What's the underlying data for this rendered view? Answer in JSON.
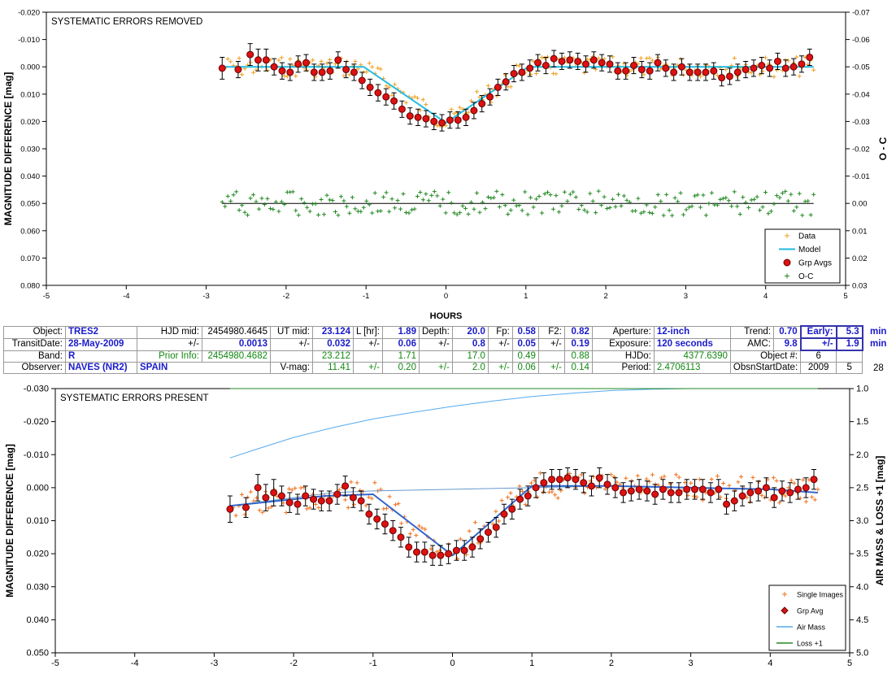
{
  "chart_data": [
    {
      "type": "scatter",
      "title": "SYSTEMATIC ERRORS REMOVED",
      "xlabel": "HOURS",
      "ylabel": "MAGNITUDE DIFFERENCE [mag]",
      "y2label": "O - C",
      "xlim": [
        -5,
        5
      ],
      "ylim": [
        -0.02,
        0.08
      ],
      "y_inverted": true,
      "y2lim": [
        -0.07,
        0.03
      ],
      "x_ticks": [
        "-5",
        "-4",
        "-3",
        "-2",
        "-1",
        "0",
        "1",
        "2",
        "3",
        "4",
        "5"
      ],
      "y_ticks": [
        "-0.020",
        "-0.010",
        "0.000",
        "0.010",
        "0.020",
        "0.030",
        "0.040",
        "0.050",
        "0.060",
        "0.070",
        "0.080"
      ],
      "y2_ticks": [
        "-0.07",
        "-0.06",
        "-0.05",
        "-0.04",
        "-0.03",
        "-0.02",
        "-0.01",
        "0.00",
        "0.01",
        "0.02",
        "0.03"
      ],
      "legend": {
        "position": "bottom-right",
        "entries": [
          "Data",
          "Model",
          "Grp Avgs",
          "O-C"
        ]
      },
      "colors": {
        "data": "#f0a020",
        "model": "#22bbdd",
        "grp": "#dd1111",
        "oc": "#228822",
        "baseline": "#000000"
      },
      "model": {
        "x": [
          -2.8,
          -1.03,
          0.0,
          1.03,
          4.6
        ],
        "y": [
          0.0,
          0.0,
          0.0205,
          0.0,
          0.0
        ]
      },
      "grp_avgs": {
        "x": [
          -2.8,
          -2.6,
          -2.45,
          -2.35,
          -2.25,
          -2.15,
          -2.05,
          -1.95,
          -1.85,
          -1.75,
          -1.65,
          -1.55,
          -1.45,
          -1.35,
          -1.25,
          -1.15,
          -1.05,
          -0.95,
          -0.85,
          -0.75,
          -0.65,
          -0.55,
          -0.45,
          -0.35,
          -0.25,
          -0.15,
          -0.05,
          0.05,
          0.15,
          0.25,
          0.35,
          0.45,
          0.55,
          0.65,
          0.75,
          0.85,
          0.95,
          1.05,
          1.15,
          1.25,
          1.35,
          1.45,
          1.55,
          1.65,
          1.75,
          1.85,
          1.95,
          2.05,
          2.15,
          2.25,
          2.35,
          2.45,
          2.55,
          2.65,
          2.75,
          2.85,
          2.95,
          3.05,
          3.15,
          3.25,
          3.35,
          3.45,
          3.55,
          3.65,
          3.75,
          3.85,
          3.95,
          4.05,
          4.15,
          4.25,
          4.35,
          4.45,
          4.55
        ],
        "y": [
          0.0005,
          0.001,
          -0.0045,
          -0.0025,
          -0.0025,
          0.0,
          0.0015,
          0.002,
          -0.001,
          -0.0015,
          0.002,
          0.002,
          0.0015,
          -0.0025,
          0.001,
          0.002,
          0.005,
          0.0075,
          0.0095,
          0.011,
          0.0125,
          0.0155,
          0.018,
          0.0185,
          0.019,
          0.02,
          0.0205,
          0.0195,
          0.0195,
          0.0185,
          0.016,
          0.0135,
          0.011,
          0.0075,
          0.0055,
          0.0025,
          0.002,
          0.0005,
          -0.0015,
          -0.0005,
          -0.003,
          -0.002,
          -0.0025,
          -0.002,
          -0.001,
          -0.0025,
          -0.0015,
          -0.001,
          0.0015,
          0.0015,
          -0.0005,
          0.001,
          0.0015,
          -0.0015,
          0.0005,
          0.002,
          0.0,
          0.002,
          0.002,
          0.002,
          0.0015,
          0.004,
          0.0035,
          0.002,
          0.001,
          0.0005,
          -0.0005,
          0.0005,
          -0.002,
          0.0005,
          0.0,
          -0.001,
          -0.0035
        ],
        "err": [
          0.004,
          0.003,
          0.004,
          0.004,
          0.004,
          0.003,
          0.003,
          0.003,
          0.003,
          0.003,
          0.003,
          0.003,
          0.003,
          0.003,
          0.003,
          0.003,
          0.003,
          0.003,
          0.003,
          0.003,
          0.003,
          0.003,
          0.003,
          0.003,
          0.003,
          0.003,
          0.003,
          0.003,
          0.003,
          0.003,
          0.003,
          0.003,
          0.003,
          0.003,
          0.003,
          0.003,
          0.003,
          0.003,
          0.003,
          0.003,
          0.003,
          0.003,
          0.003,
          0.003,
          0.003,
          0.003,
          0.003,
          0.003,
          0.003,
          0.003,
          0.003,
          0.003,
          0.003,
          0.003,
          0.003,
          0.003,
          0.003,
          0.003,
          0.003,
          0.003,
          0.003,
          0.003,
          0.003,
          0.003,
          0.003,
          0.003,
          0.003,
          0.003,
          0.003,
          0.003,
          0.003,
          0.003,
          0.003
        ]
      },
      "oc_baseline": 0.0
    },
    {
      "type": "scatter",
      "title": "SYSTEMATIC ERRORS PRESENT",
      "ylabel": "MAGNITUDE DIFFERENCE [mag]",
      "y2label": "AIR MASS & LOSS +1 [mag]",
      "xlim": [
        -5,
        5
      ],
      "ylim": [
        -0.03,
        0.05
      ],
      "y_inverted": true,
      "y2lim": [
        1.0,
        5.0
      ],
      "x_ticks": [
        "-5",
        "-4",
        "-3",
        "-2",
        "-1",
        "0",
        "1",
        "2",
        "3",
        "4",
        "5"
      ],
      "y_ticks": [
        "-0.030",
        "-0.020",
        "-0.010",
        "0.000",
        "0.010",
        "0.020",
        "0.030",
        "0.040",
        "0.050"
      ],
      "y2_ticks": [
        "5.0",
        "4.5",
        "4.0",
        "3.5",
        "3.0",
        "2.5",
        "2.0",
        "1.5",
        "1.0"
      ],
      "legend": {
        "position": "bottom-right",
        "entries": [
          "Single Images",
          "Grp Avg",
          "Air Mass",
          "Loss +1"
        ]
      },
      "colors": {
        "single": "#f0701a",
        "grp": "#dd1111",
        "airmass": "#55aaee",
        "loss": "#228822",
        "model": "#3366cc",
        "trend": "#6699cc"
      },
      "grp_avg": {
        "x": [
          -2.8,
          -2.6,
          -2.45,
          -2.35,
          -2.25,
          -2.15,
          -2.05,
          -1.95,
          -1.85,
          -1.75,
          -1.65,
          -1.55,
          -1.45,
          -1.35,
          -1.25,
          -1.15,
          -1.05,
          -0.95,
          -0.85,
          -0.75,
          -0.65,
          -0.55,
          -0.45,
          -0.35,
          -0.25,
          -0.15,
          -0.05,
          0.05,
          0.15,
          0.25,
          0.35,
          0.45,
          0.55,
          0.65,
          0.75,
          0.85,
          0.95,
          1.05,
          1.15,
          1.25,
          1.35,
          1.45,
          1.55,
          1.65,
          1.75,
          1.85,
          1.95,
          2.05,
          2.15,
          2.25,
          2.35,
          2.45,
          2.55,
          2.65,
          2.75,
          2.85,
          2.95,
          3.05,
          3.15,
          3.25,
          3.35,
          3.45,
          3.55,
          3.65,
          3.75,
          3.85,
          3.95,
          4.05,
          4.15,
          4.25,
          4.35,
          4.45,
          4.55
        ],
        "y": [
          0.0065,
          0.006,
          0.0,
          0.003,
          0.0015,
          0.0025,
          0.0045,
          0.005,
          0.0025,
          0.0035,
          0.004,
          0.004,
          0.002,
          -0.0005,
          0.003,
          0.004,
          0.008,
          0.0095,
          0.011,
          0.013,
          0.015,
          0.018,
          0.0195,
          0.0195,
          0.0205,
          0.0205,
          0.02,
          0.019,
          0.019,
          0.018,
          0.0155,
          0.0135,
          0.012,
          0.008,
          0.0065,
          0.0035,
          0.0025,
          0.0,
          -0.0015,
          -0.0025,
          -0.0025,
          -0.003,
          -0.0025,
          -0.0015,
          -0.0005,
          -0.003,
          -0.001,
          0.0,
          0.0015,
          0.001,
          0.0005,
          0.001,
          0.002,
          0.0005,
          0.0015,
          0.0015,
          0.0005,
          0.0005,
          0.0005,
          0.0015,
          0.0005,
          0.005,
          0.004,
          0.0025,
          0.0015,
          0.001,
          0.0,
          0.003,
          0.001,
          0.0015,
          0.0005,
          0.0,
          -0.0025
        ],
        "err": [
          0.004,
          0.003,
          0.004,
          0.004,
          0.004,
          0.003,
          0.003,
          0.003,
          0.003,
          0.003,
          0.003,
          0.003,
          0.003,
          0.003,
          0.003,
          0.003,
          0.003,
          0.003,
          0.003,
          0.003,
          0.003,
          0.003,
          0.003,
          0.003,
          0.003,
          0.003,
          0.003,
          0.003,
          0.003,
          0.003,
          0.003,
          0.003,
          0.003,
          0.003,
          0.003,
          0.003,
          0.003,
          0.003,
          0.003,
          0.003,
          0.003,
          0.003,
          0.003,
          0.003,
          0.003,
          0.003,
          0.003,
          0.003,
          0.003,
          0.003,
          0.003,
          0.003,
          0.003,
          0.003,
          0.003,
          0.003,
          0.003,
          0.003,
          0.003,
          0.003,
          0.003,
          0.003,
          0.003,
          0.003,
          0.003,
          0.003,
          0.003,
          0.003,
          0.003,
          0.003,
          0.003,
          0.003,
          0.003
        ]
      },
      "model_curve": {
        "x": [
          -2.8,
          -2.0,
          -1.6,
          -1.0,
          0.0,
          1.0,
          2.0,
          3.0,
          4.0,
          4.6
        ],
        "y": [
          0.0055,
          0.0035,
          0.0025,
          0.002,
          0.0205,
          -0.0005,
          -0.0005,
          0.0,
          0.0005,
          0.0015
        ]
      },
      "trend_curve": {
        "x": [
          -2.8,
          -2.0,
          -1.5,
          -1.0,
          0.0,
          1.0,
          2.0,
          3.0,
          4.0,
          4.6
        ],
        "y": [
          0.0055,
          0.003,
          0.0015,
          0.001,
          0.0005,
          0.0,
          -0.0005,
          0.0,
          0.0005,
          0.0015
        ]
      },
      "air_mass": {
        "x": [
          -2.8,
          -2.5,
          -2.0,
          -1.5,
          -1.0,
          -0.5,
          0.0,
          0.5,
          1.0,
          1.5,
          2.0,
          2.5,
          3.0,
          3.5,
          4.0
        ],
        "y": [
          2.05,
          1.93,
          1.74,
          1.59,
          1.46,
          1.36,
          1.27,
          1.19,
          1.12,
          1.07,
          1.03,
          1.01,
          1.0,
          1.0,
          1.0
        ]
      },
      "loss": {
        "x": [
          -2.8,
          4.6
        ],
        "y": [
          1.0,
          1.0
        ]
      }
    }
  ],
  "info": {
    "object_label": "Object:",
    "object": "TRES2",
    "hjd_mid_label": "HJD mid:",
    "hjd_mid": "2454980.4645",
    "ut_mid_label": "UT mid:",
    "ut_mid": "23.124",
    "l_hr_label": "L [hr]:",
    "l_hr": "1.89",
    "depth_label": "Depth:",
    "depth": "20.0",
    "fp_label": "Fp:",
    "fp": "0.58",
    "f2_label": "F2:",
    "f2": "0.82",
    "aperture_label": "Aperture:",
    "aperture": "12-inch",
    "trend_label": "Trend:",
    "trend": "0.70",
    "early_label": "Early:",
    "early": "5.3",
    "early_unit": "min",
    "transit_date_label": "TransitDate:",
    "transit_date": "28-May-2009",
    "pm": "+/-",
    "hjd_err": "0.0013",
    "ut_err": "0.032",
    "l_err": "0.06",
    "depth_err": "0.8",
    "fp_err": "0.05",
    "f2_err": "0.19",
    "exposure_label": "Exposure:",
    "exposure": "120 seconds",
    "amc_label": "AMC:",
    "amc": "9.8",
    "early_err": "1.9",
    "early_err_unit": "min",
    "band_label": "Band:",
    "band": "R",
    "prior_info_label": "Prior Info:",
    "prior_hjd": "2454980.4682",
    "prior_ut": "23.212",
    "prior_l": "1.71",
    "prior_depth": "17.0",
    "prior_fp": "0.49",
    "prior_f2": "0.88",
    "hjdo_label": "HJDo:",
    "hjdo": "4377.6390",
    "object_num_label": "Object #:",
    "object_num": "6",
    "observer_label": "Observer:",
    "observer": "NAVES (NR2)",
    "location": "SPAIN",
    "vmag_label": "V-mag:",
    "vmag": "11.41",
    "vmag_err": "0.20",
    "depth_err2": "2.0",
    "fp_err2": "0.06",
    "f2_err2": "0.14",
    "period_label": "Period:",
    "period": "2.4706113",
    "obsn_start_label": "ObsnStartDate:",
    "obsn_year": "2009",
    "obsn_month": "5",
    "obsn_day": "28"
  }
}
